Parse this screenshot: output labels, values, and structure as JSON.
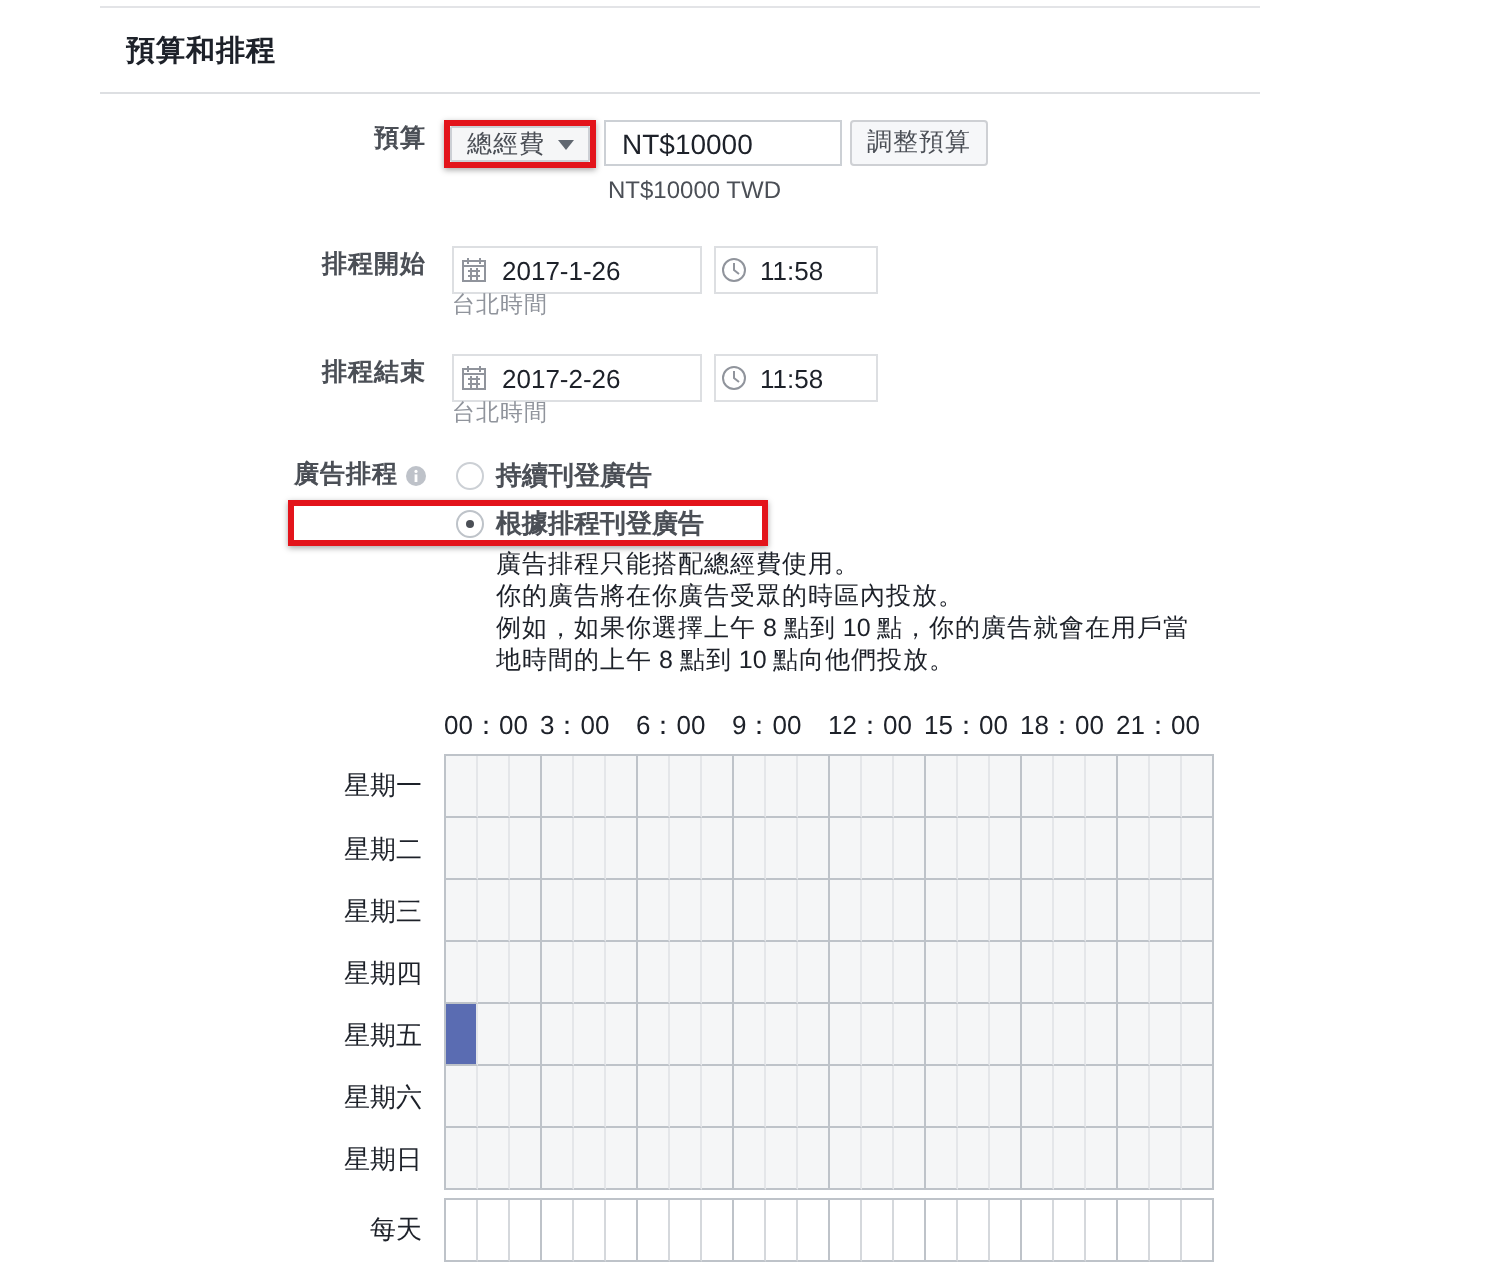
{
  "section": {
    "title": "預算和排程"
  },
  "budget": {
    "label": "預算",
    "budget_type": {
      "value": "總經費",
      "highlighted": true
    },
    "amount": {
      "value": "NT$10000"
    },
    "adjust_button": "調整預算",
    "converted": "NT$10000 TWD"
  },
  "schedule_start": {
    "label": "排程開始",
    "date": "2017-1-26",
    "time": "11:58",
    "timezone": "台北時間"
  },
  "schedule_end": {
    "label": "排程結束",
    "date": "2017-2-26",
    "time": "11:58",
    "timezone": "台北時間"
  },
  "ad_scheduling": {
    "label": "廣告排程",
    "options": [
      {
        "label": "持續刊登廣告",
        "selected": false,
        "highlighted": false
      },
      {
        "label": "根據排程刊登廣告",
        "selected": true,
        "highlighted": true
      }
    ],
    "notes": [
      "廣告排程只能搭配總經費使用。",
      "你的廣告將在你廣告受眾的時區內投放。",
      "例如，如果你選擇上午 8 點到 10 點，你的廣告就會在用戶當地時間的上午 8 點到 10 點向他們投放。"
    ]
  },
  "schedule_grid": {
    "hours": [
      "00：00",
      "3：00",
      "6：00",
      "9：00",
      "12：00",
      "15：00",
      "18：00",
      "21：00"
    ],
    "days": [
      {
        "label": "星期一",
        "cells": [
          {
            "selected": false
          },
          {
            "selected": false
          },
          {
            "selected": false
          },
          {
            "selected": false
          },
          {
            "selected": false
          },
          {
            "selected": false
          },
          {
            "selected": false
          },
          {
            "selected": false
          },
          {
            "selected": false
          },
          {
            "selected": false
          },
          {
            "selected": false
          },
          {
            "selected": false
          },
          {
            "selected": false
          },
          {
            "selected": false
          },
          {
            "selected": false
          },
          {
            "selected": false
          },
          {
            "selected": false
          },
          {
            "selected": false
          },
          {
            "selected": false
          },
          {
            "selected": false
          },
          {
            "selected": false
          },
          {
            "selected": false
          },
          {
            "selected": false
          },
          {
            "selected": false
          }
        ]
      },
      {
        "label": "星期二",
        "cells": [
          {
            "selected": false
          },
          {
            "selected": false
          },
          {
            "selected": false
          },
          {
            "selected": false
          },
          {
            "selected": false
          },
          {
            "selected": false
          },
          {
            "selected": false
          },
          {
            "selected": false
          },
          {
            "selected": false
          },
          {
            "selected": false
          },
          {
            "selected": false
          },
          {
            "selected": false
          },
          {
            "selected": false
          },
          {
            "selected": false
          },
          {
            "selected": false
          },
          {
            "selected": false
          },
          {
            "selected": false
          },
          {
            "selected": false
          },
          {
            "selected": false
          },
          {
            "selected": false
          },
          {
            "selected": false
          },
          {
            "selected": false
          },
          {
            "selected": false
          },
          {
            "selected": false
          }
        ]
      },
      {
        "label": "星期三",
        "cells": [
          {
            "selected": false
          },
          {
            "selected": false
          },
          {
            "selected": false
          },
          {
            "selected": false
          },
          {
            "selected": false
          },
          {
            "selected": false
          },
          {
            "selected": false
          },
          {
            "selected": false
          },
          {
            "selected": false
          },
          {
            "selected": false
          },
          {
            "selected": false
          },
          {
            "selected": false
          },
          {
            "selected": false
          },
          {
            "selected": false
          },
          {
            "selected": false
          },
          {
            "selected": false
          },
          {
            "selected": false
          },
          {
            "selected": false
          },
          {
            "selected": false
          },
          {
            "selected": false
          },
          {
            "selected": false
          },
          {
            "selected": false
          },
          {
            "selected": false
          },
          {
            "selected": false
          }
        ]
      },
      {
        "label": "星期四",
        "cells": [
          {
            "selected": false
          },
          {
            "selected": false
          },
          {
            "selected": false
          },
          {
            "selected": false
          },
          {
            "selected": false
          },
          {
            "selected": false
          },
          {
            "selected": false
          },
          {
            "selected": false
          },
          {
            "selected": false
          },
          {
            "selected": false
          },
          {
            "selected": false
          },
          {
            "selected": false
          },
          {
            "selected": false
          },
          {
            "selected": false
          },
          {
            "selected": false
          },
          {
            "selected": false
          },
          {
            "selected": false
          },
          {
            "selected": false
          },
          {
            "selected": false
          },
          {
            "selected": false
          },
          {
            "selected": false
          },
          {
            "selected": false
          },
          {
            "selected": false
          },
          {
            "selected": false
          }
        ]
      },
      {
        "label": "星期五",
        "cells": [
          {
            "selected": true
          },
          {
            "selected": false
          },
          {
            "selected": false
          },
          {
            "selected": false
          },
          {
            "selected": false
          },
          {
            "selected": false
          },
          {
            "selected": false
          },
          {
            "selected": false
          },
          {
            "selected": false
          },
          {
            "selected": false
          },
          {
            "selected": false
          },
          {
            "selected": false
          },
          {
            "selected": false
          },
          {
            "selected": false
          },
          {
            "selected": false
          },
          {
            "selected": false
          },
          {
            "selected": false
          },
          {
            "selected": false
          },
          {
            "selected": false
          },
          {
            "selected": false
          },
          {
            "selected": false
          },
          {
            "selected": false
          },
          {
            "selected": false
          },
          {
            "selected": false
          }
        ]
      },
      {
        "label": "星期六",
        "cells": [
          {
            "selected": false
          },
          {
            "selected": false
          },
          {
            "selected": false
          },
          {
            "selected": false
          },
          {
            "selected": false
          },
          {
            "selected": false
          },
          {
            "selected": false
          },
          {
            "selected": false
          },
          {
            "selected": false
          },
          {
            "selected": false
          },
          {
            "selected": false
          },
          {
            "selected": false
          },
          {
            "selected": false
          },
          {
            "selected": false
          },
          {
            "selected": false
          },
          {
            "selected": false
          },
          {
            "selected": false
          },
          {
            "selected": false
          },
          {
            "selected": false
          },
          {
            "selected": false
          },
          {
            "selected": false
          },
          {
            "selected": false
          },
          {
            "selected": false
          },
          {
            "selected": false
          }
        ]
      },
      {
        "label": "星期日",
        "cells": [
          {
            "selected": false
          },
          {
            "selected": false
          },
          {
            "selected": false
          },
          {
            "selected": false
          },
          {
            "selected": false
          },
          {
            "selected": false
          },
          {
            "selected": false
          },
          {
            "selected": false
          },
          {
            "selected": false
          },
          {
            "selected": false
          },
          {
            "selected": false
          },
          {
            "selected": false
          },
          {
            "selected": false
          },
          {
            "selected": false
          },
          {
            "selected": false
          },
          {
            "selected": false
          },
          {
            "selected": false
          },
          {
            "selected": false
          },
          {
            "selected": false
          },
          {
            "selected": false
          },
          {
            "selected": false
          },
          {
            "selected": false
          },
          {
            "selected": false
          },
          {
            "selected": false
          }
        ]
      }
    ],
    "every_day": {
      "label": "每天",
      "cells": [
        {
          "selected": false
        },
        {
          "selected": false
        },
        {
          "selected": false
        },
        {
          "selected": false
        },
        {
          "selected": false
        },
        {
          "selected": false
        },
        {
          "selected": false
        },
        {
          "selected": false
        },
        {
          "selected": false
        },
        {
          "selected": false
        },
        {
          "selected": false
        },
        {
          "selected": false
        },
        {
          "selected": false
        },
        {
          "selected": false
        },
        {
          "selected": false
        },
        {
          "selected": false
        },
        {
          "selected": false
        },
        {
          "selected": false
        },
        {
          "selected": false
        },
        {
          "selected": false
        },
        {
          "selected": false
        },
        {
          "selected": false
        },
        {
          "selected": false
        },
        {
          "selected": false
        }
      ]
    }
  }
}
